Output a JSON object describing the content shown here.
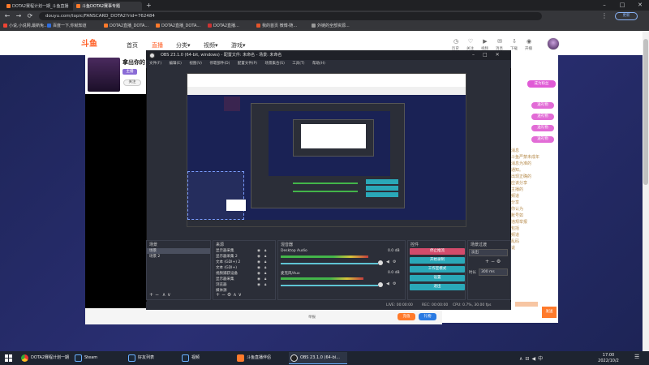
{
  "browser": {
    "tabs": [
      {
        "label": "DOTA2赛程计划一期_斗鱼直播",
        "active": false
      },
      {
        "label": "斗鱼DOTA2赛事专题",
        "active": true
      }
    ],
    "url": "douyu.com/topic/FANSCARD_DOTA2?rid=762484",
    "bookmarks": [
      "小说,小说网,最新免...",
      "百度一下,你就知道",
      "DOTA2直播_DOTA...",
      "DOTA2直播_DOTA...",
      "DOTA2直播...",
      "我的首页 微博-随...",
      "外链的全部资源..."
    ]
  },
  "site": {
    "logo": "斗鱼",
    "nav": [
      {
        "label": "首页",
        "active": false
      },
      {
        "label": "直播",
        "active": true
      },
      {
        "label": "分类▾",
        "active": false
      },
      {
        "label": "视频▾",
        "active": false
      },
      {
        "label": "游戏▾",
        "active": false
      }
    ],
    "header_icons": [
      {
        "icon": "history-icon",
        "label": "历史"
      },
      {
        "icon": "follow-icon",
        "label": "关注"
      },
      {
        "icon": "video-icon",
        "label": "视频"
      },
      {
        "icon": "message-icon",
        "label": "消息"
      },
      {
        "icon": "download-icon",
        "label": "下载"
      },
      {
        "icon": "live-icon",
        "label": "开播"
      }
    ],
    "room_title": "拿出你的",
    "room_tag": "主播",
    "follow_button": "关注",
    "join_fans": "成为粉丝",
    "chat_lines": [
      "消息",
      "斗鱼严禁未成年",
      "消息为准的",
      "通知。",
      "出现正确的",
      "应该分享",
      "主播的",
      "频道",
      "分享",
      "你认为",
      "账号如",
      "违规举报",
      "包括",
      "频道",
      "乱码",
      "说"
    ],
    "gifts": [
      "送礼物",
      "送礼物",
      "送礼物",
      "送礼物"
    ],
    "send_button": "发送",
    "gift_button": "礼物",
    "recharge_button": "充值",
    "report_button": "举报"
  },
  "obs": {
    "title": "OBS 23.1.0 (64-bit, windows) - 配置文件: 未命名 - 场景: 未命名",
    "menu": [
      "文件(F)",
      "编辑(E)",
      "视图(V)",
      "停靠部件(D)",
      "配置文件(P)",
      "场景集合(S)",
      "工具(T)",
      "帮助(H)"
    ],
    "docks": {
      "scenes": {
        "title": "场景",
        "items": [
          {
            "label": "场景",
            "selected": true
          },
          {
            "label": "场景 2",
            "selected": false
          }
        ]
      },
      "sources": {
        "title": "来源",
        "items": [
          "显示器采集",
          "显示器采集 2",
          "文本 (GDI+) 2",
          "文本 (GDI+)",
          "视频捕获设备",
          "显示器采集",
          "浏览器",
          "媒体源"
        ]
      },
      "mixer": {
        "title": "混音器",
        "channels": [
          {
            "name": "Desktop Audio",
            "db": "0.0 dB",
            "level": 0.72
          },
          {
            "name": "麦克风/Aux",
            "db": "0.0 dB",
            "level": 0.68
          }
        ]
      },
      "transitions": {
        "title": "场景过渡",
        "type": "淡出",
        "duration_label": "时长",
        "duration": "300 ms"
      },
      "controls": {
        "title": "控件",
        "buttons": [
          "停止推流",
          "开始录制",
          "工作室模式",
          "设置",
          "退出"
        ]
      }
    },
    "status": {
      "live": "LIVE: 00:00:00",
      "rec": "REC: 00:00:00",
      "cpu": "CPU: 0.7%, 30.00 fps"
    }
  },
  "taskbar": {
    "items": [
      {
        "label": "DOTA2赛程计划一期",
        "active": false
      },
      {
        "label": "Steam",
        "active": false
      },
      {
        "label": "好友列表",
        "active": false
      },
      {
        "label": "视频",
        "active": false
      },
      {
        "label": "斗鱼直播伴侣",
        "active": false
      },
      {
        "label": "OBS 23.1.0 (64-bi...",
        "active": true
      }
    ],
    "time": "17:00",
    "date": "2022/10/2"
  }
}
